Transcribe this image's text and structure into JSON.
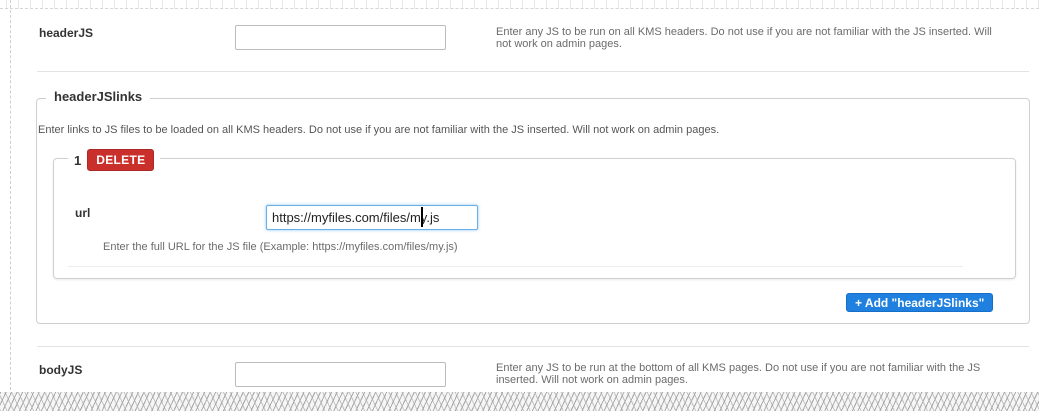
{
  "headerJS": {
    "label": "headerJS",
    "value": "",
    "help": "Enter any JS to be run on all KMS headers. Do not use if you are not familiar with the JS inserted. Will not work on admin pages."
  },
  "headerJSlinks": {
    "legend": "headerJSlinks",
    "description": "Enter links to JS files to be loaded on all KMS headers. Do not use if you are not familiar with the JS inserted. Will not work on admin pages.",
    "items": [
      {
        "number": "1",
        "delete_label": "DELETE",
        "url_label": "url",
        "url_value": "https://myfiles.com/files/my.js",
        "url_help": "Enter the full URL for the JS file (Example: https://myfiles.com/files/my.js)"
      }
    ],
    "add_label": "+ Add \"headerJSlinks\""
  },
  "bodyJS": {
    "label": "bodyJS",
    "value": "",
    "help": "Enter any JS to be run at the bottom of all KMS pages. Do not use if you are not familiar with the JS inserted. Will not work on admin pages."
  },
  "colors": {
    "delete": "#c9302c",
    "add": "#1f80e0",
    "focus": "#66afe9"
  }
}
